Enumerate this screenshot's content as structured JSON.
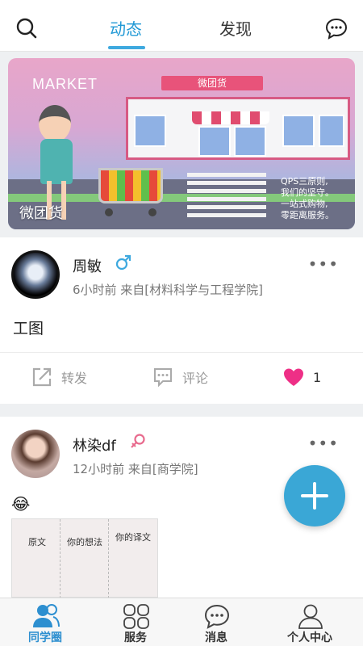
{
  "header": {
    "tabs": [
      {
        "label": "动态",
        "active": true
      },
      {
        "label": "发现",
        "active": false
      }
    ],
    "accent_color": "#1f98d5"
  },
  "banner": {
    "market_text": "MARKET",
    "store_sign": "微团货",
    "slogan_lines": [
      "QPS三原则,",
      "我们的坚守。",
      "一站式购物,",
      "零距离服务。"
    ],
    "caption": "微团货"
  },
  "posts": [
    {
      "name": "周敏",
      "gender": "male",
      "meta": "6小时前 来自[材料科学与工程学院]",
      "content": "工图",
      "actions": {
        "share": "转发",
        "comment": "评论",
        "like_count": "1"
      }
    },
    {
      "name": "林染df",
      "gender": "female",
      "meta": "12小时前 来自[商学院]",
      "emoji": "😂",
      "meme_labels": [
        "原文",
        "你的想法",
        "你的译文"
      ]
    }
  ],
  "nav": {
    "items": [
      {
        "label": "同学圈",
        "icon": "people-icon",
        "active": true
      },
      {
        "label": "服务",
        "icon": "grid-icon",
        "active": false
      },
      {
        "label": "消息",
        "icon": "message-icon",
        "active": false
      },
      {
        "label": "个人中心",
        "icon": "person-icon",
        "active": false
      }
    ]
  }
}
